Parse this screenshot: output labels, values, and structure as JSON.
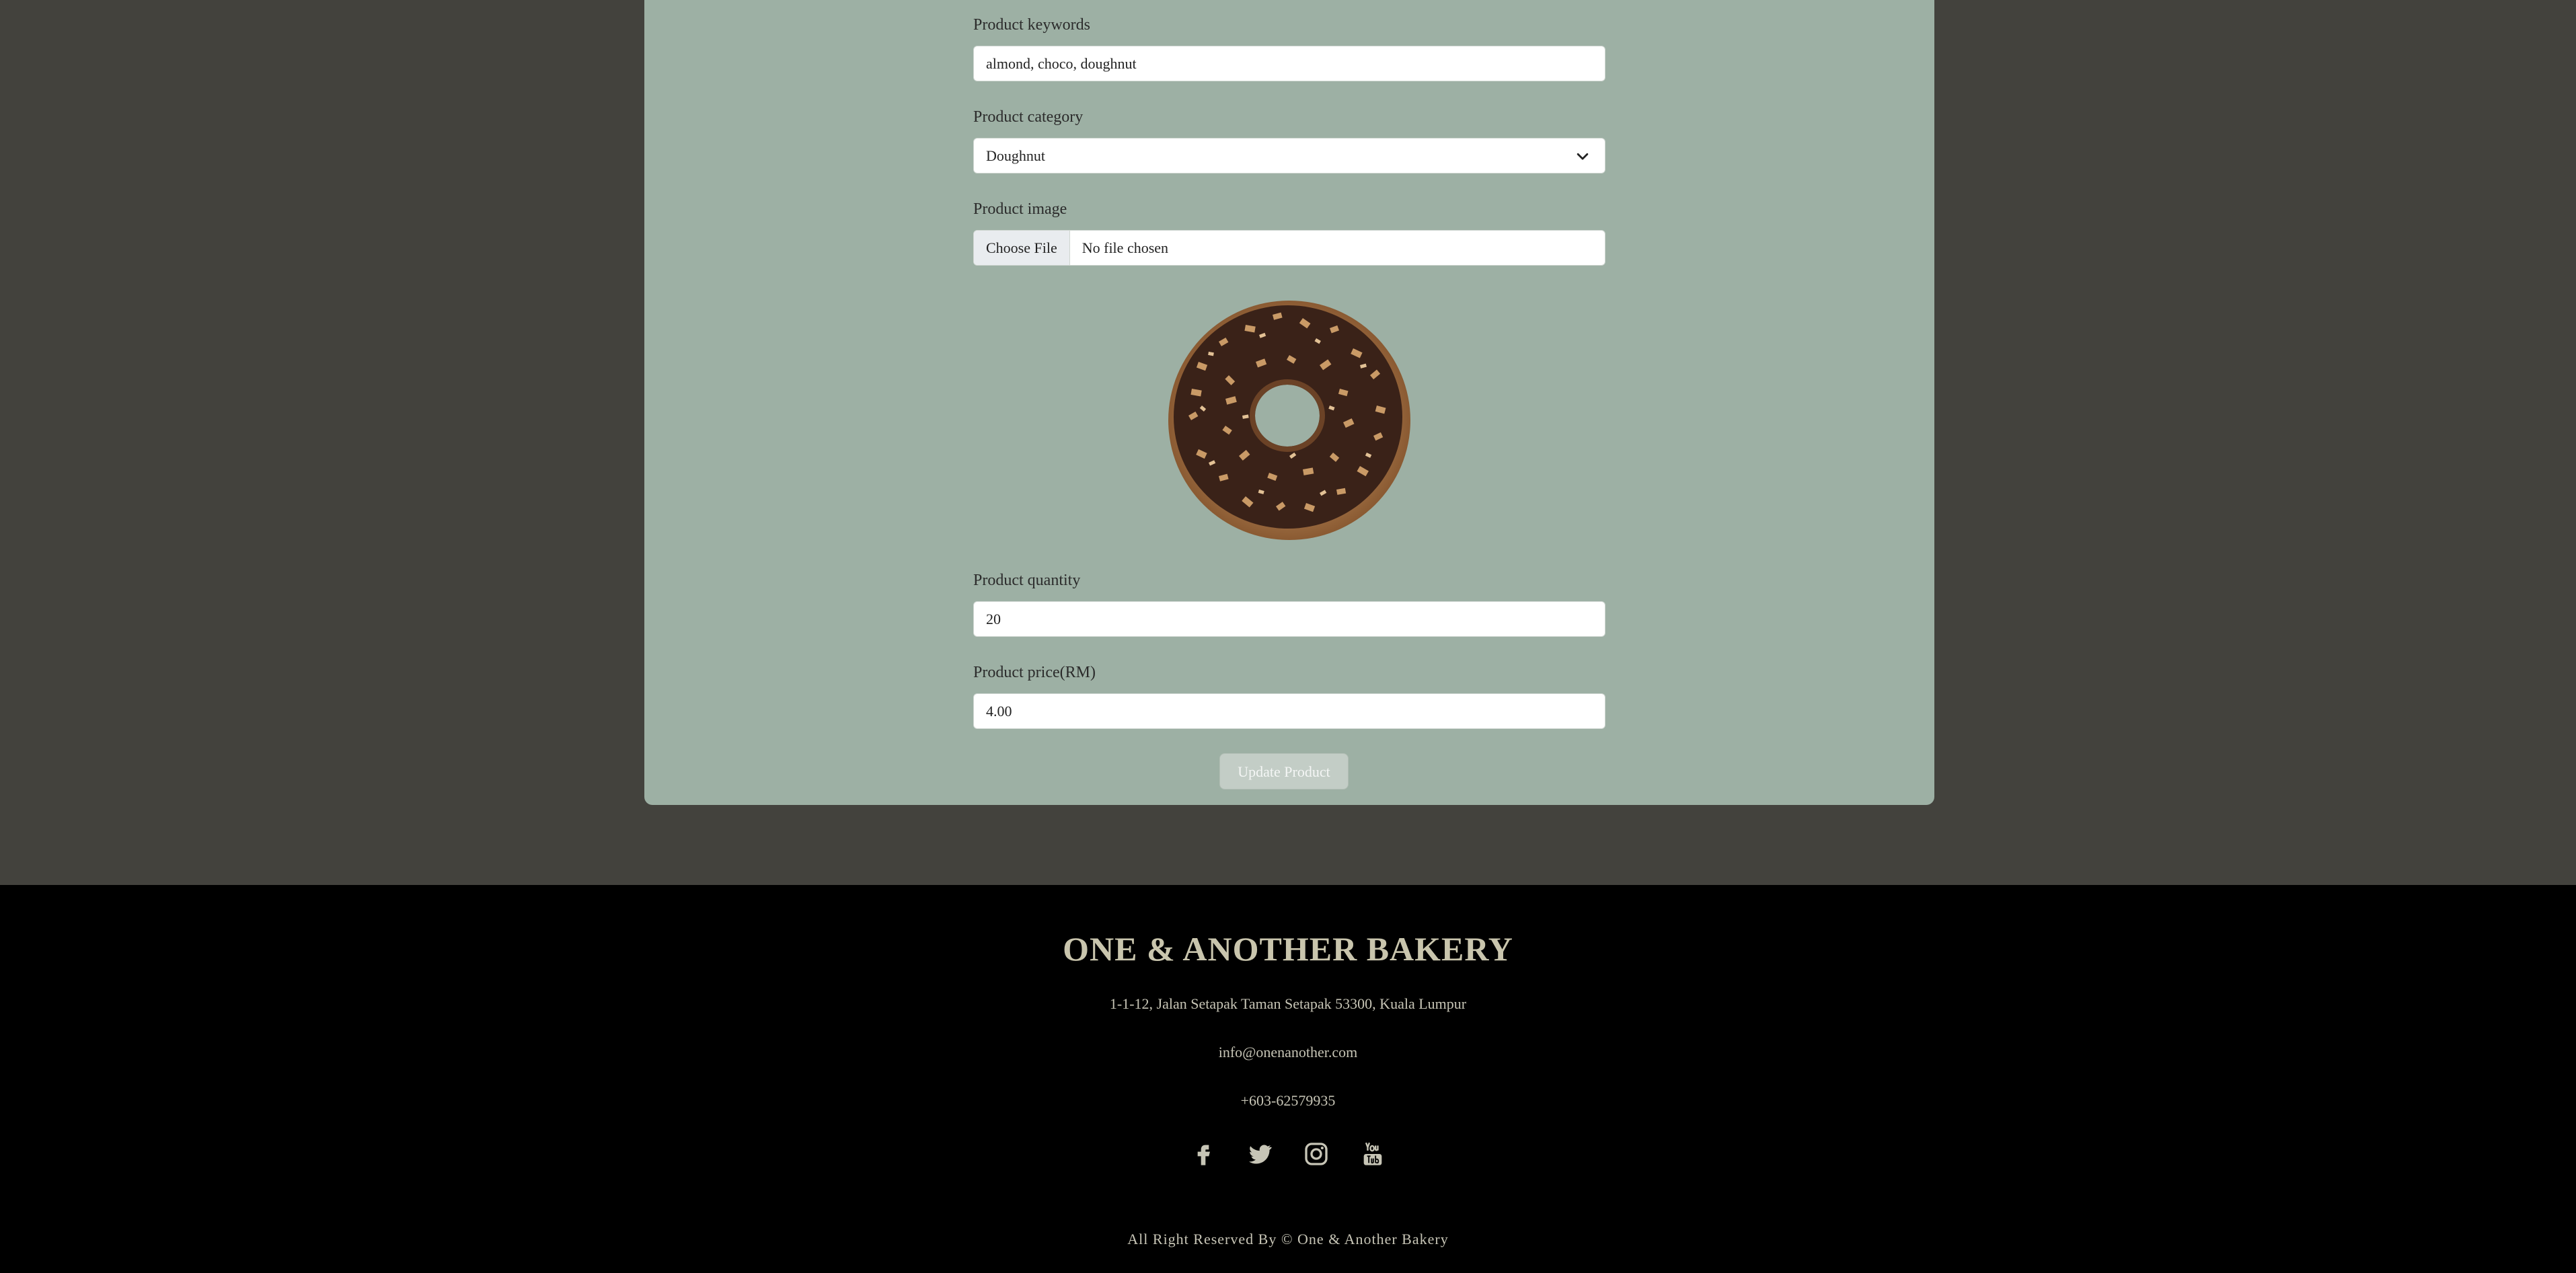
{
  "form": {
    "keywords": {
      "label": "Product keywords",
      "value": "almond, choco, doughnut"
    },
    "category": {
      "label": "Product category",
      "selected": "Doughnut"
    },
    "image": {
      "label": "Product image",
      "choose_label": "Choose File",
      "status": "No file chosen"
    },
    "quantity": {
      "label": "Product quantity",
      "value": "20"
    },
    "price": {
      "label": "Product price(RM)",
      "value": "4.00"
    },
    "submit_label": "Update Product"
  },
  "footer": {
    "brand": "ONE & ANOTHER BAKERY",
    "address": "1-1-12, Jalan Setapak Taman Setapak 53300, Kuala Lumpur",
    "email": "info@onenanother.com",
    "phone": "+603-62579935",
    "social": [
      "facebook-icon",
      "twitter-icon",
      "instagram-icon",
      "youtube-icon"
    ],
    "copyright": "All Right Reserved By © One & Another Bakery"
  },
  "colors": {
    "page_background": "#43423d",
    "card_background": "#9db0a4",
    "footer_background": "#000000",
    "footer_text": "#c7c5b6"
  }
}
